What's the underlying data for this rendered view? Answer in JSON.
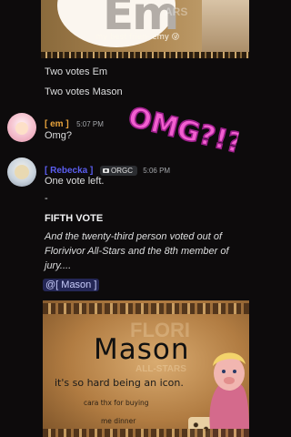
{
  "top_card": {
    "big_text": "Em",
    "ghost_text": "ARS",
    "caption": "my best frien- emy 😜"
  },
  "messages": {
    "line1": "Two votes Em",
    "line2": "Two votes Mason",
    "em": {
      "username": "[ em ]",
      "timestamp": "5:07 PM",
      "text": "Omg?",
      "sticker_text": "OMG?!?",
      "name_color": "#e8a33c"
    },
    "host": {
      "username": "[ Rebecka ]",
      "tag_icon": "camera-icon",
      "tag": "ORGC",
      "timestamp": "5:06 PM",
      "text": "One vote left.",
      "dash": "-",
      "heading": "FIFTH VOTE",
      "body": "And the twenty-third person voted out of Florivivor All-Stars and the 8th member of jury....",
      "mention": "@[ Mason ]",
      "name_color": "#5b5ef0"
    }
  },
  "bottom_card": {
    "ghost_title": "FLORI",
    "ghost_sub": "ALL-STARS",
    "title": "Mason",
    "quote": "it's so hard being an icon.",
    "thanks": "cara thx for buying",
    "dinner": "me dinner"
  }
}
